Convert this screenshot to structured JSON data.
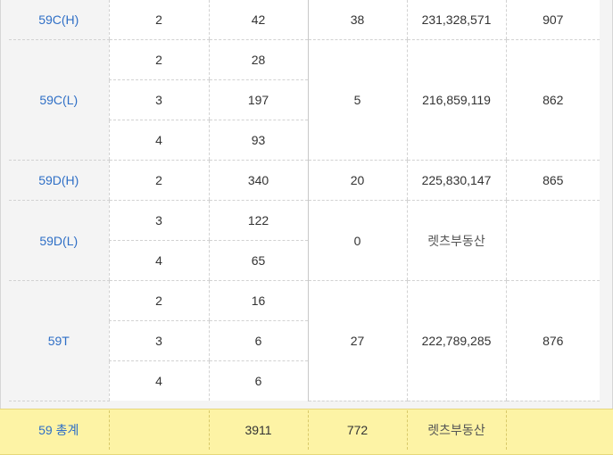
{
  "rows": [
    {
      "type": "59C(H)",
      "rooms": [
        "2"
      ],
      "units": [
        "42"
      ],
      "applicants": "38",
      "price": "231,328,571",
      "rate": "907"
    },
    {
      "type": "59C(L)",
      "rooms": [
        "2",
        "3",
        "4"
      ],
      "units": [
        "28",
        "197",
        "93"
      ],
      "applicants": "5",
      "price": "216,859,119",
      "rate": "862"
    },
    {
      "type": "59D(H)",
      "rooms": [
        "2"
      ],
      "units": [
        "340"
      ],
      "applicants": "20",
      "price": "225,830,147",
      "rate": "865"
    },
    {
      "type": "59D(L)",
      "rooms": [
        "3",
        "4"
      ],
      "units": [
        "122",
        "65"
      ],
      "applicants": "0",
      "price": "렛츠부동산",
      "rate": ""
    },
    {
      "type": "59T",
      "rooms": [
        "2",
        "3",
        "4"
      ],
      "units": [
        "16",
        "6",
        "6"
      ],
      "applicants": "27",
      "price": "222,789,285",
      "rate": "876"
    }
  ],
  "total": {
    "label": "59 총계",
    "rooms": "",
    "units": "3911",
    "applicants": "772",
    "price": "렛츠부동산",
    "rate": ""
  }
}
